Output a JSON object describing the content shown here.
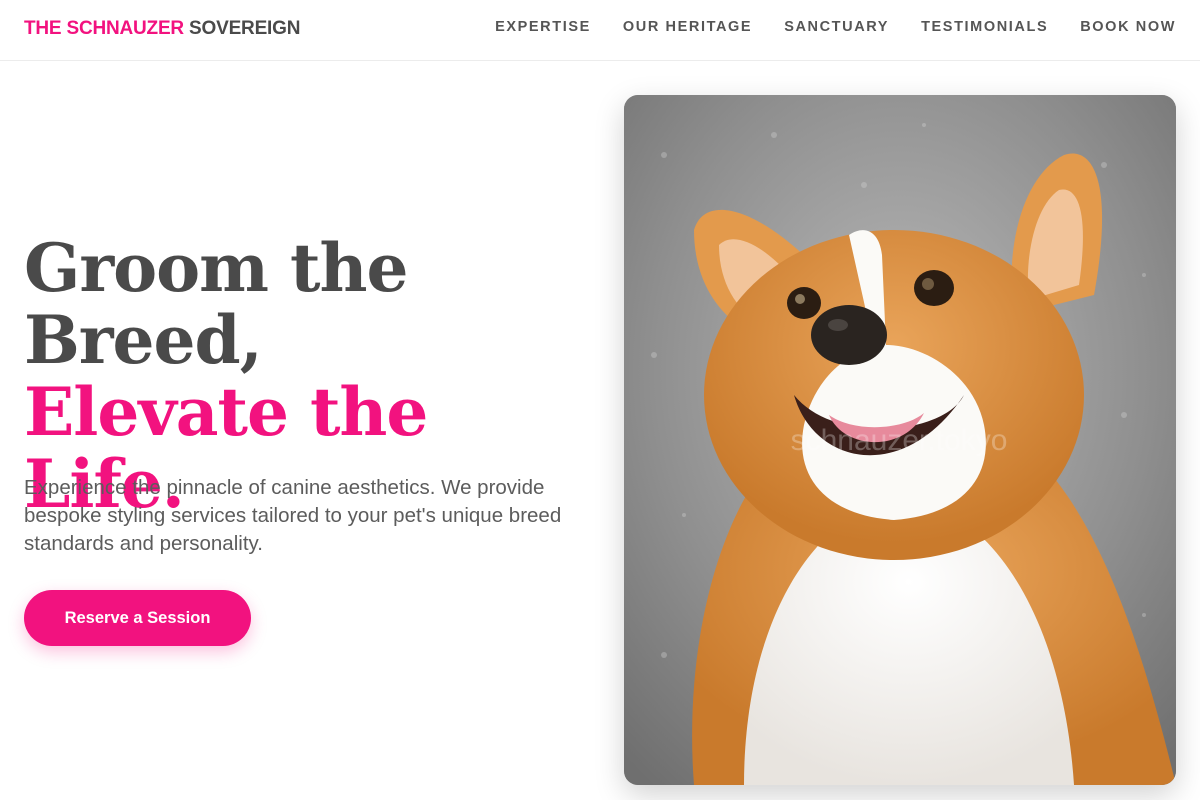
{
  "brand": {
    "part1": "THE SCHNAUZER",
    "part2": " SOVEREIGN"
  },
  "nav": {
    "items": [
      {
        "label": "EXPERTISE"
      },
      {
        "label": "OUR HERITAGE"
      },
      {
        "label": "SANCTUARY"
      },
      {
        "label": "TESTIMONIALS"
      },
      {
        "label": "BOOK NOW"
      }
    ]
  },
  "hero": {
    "headline_line1": "Groom the",
    "headline_line2": "Breed,",
    "headline_accent": "Elevate the Life.",
    "lead": "Experience the pinnacle of canine aesthetics. We provide bespoke styling services tailored to your pet's unique breed standards and personality.",
    "cta_label": "Reserve a Session",
    "photo_watermark": "schnauzer.tokyo"
  },
  "colors": {
    "accent": "#f2127f",
    "text": "#4a4a4a",
    "muted": "#5c5c5c"
  },
  "icons": {
    "hero_photo": "corgi-dog-photo"
  }
}
